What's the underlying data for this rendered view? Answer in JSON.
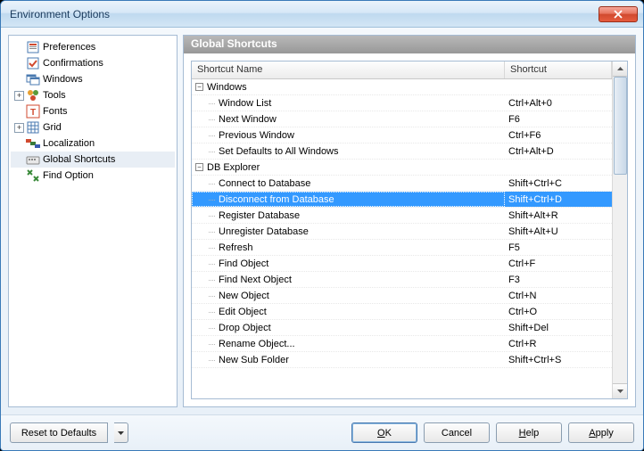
{
  "window": {
    "title": "Environment Options"
  },
  "sidebar": {
    "items": [
      {
        "label": "Preferences",
        "icon": "prefs",
        "level": 0,
        "expander": null
      },
      {
        "label": "Confirmations",
        "icon": "confirm",
        "level": 0,
        "expander": null
      },
      {
        "label": "Windows",
        "icon": "windows",
        "level": 0,
        "expander": null
      },
      {
        "label": "Tools",
        "icon": "tools",
        "level": 0,
        "expander": "plus"
      },
      {
        "label": "Fonts",
        "icon": "fonts",
        "level": 0,
        "expander": null
      },
      {
        "label": "Grid",
        "icon": "grid",
        "level": 0,
        "expander": "plus"
      },
      {
        "label": "Localization",
        "icon": "local",
        "level": 0,
        "expander": null
      },
      {
        "label": "Global Shortcuts",
        "icon": "shortcut",
        "level": 0,
        "expander": null,
        "selected": true
      },
      {
        "label": "Find Option",
        "icon": "find",
        "level": 0,
        "expander": null
      }
    ]
  },
  "main": {
    "title": "Global Shortcuts",
    "columns": {
      "name": "Shortcut Name",
      "shortcut": "Shortcut"
    },
    "rows": [
      {
        "type": "group",
        "label": "Windows",
        "expanded": true
      },
      {
        "type": "item",
        "label": "Window List",
        "shortcut": "Ctrl+Alt+0"
      },
      {
        "type": "item",
        "label": "Next Window",
        "shortcut": "F6"
      },
      {
        "type": "item",
        "label": "Previous Window",
        "shortcut": "Ctrl+F6"
      },
      {
        "type": "item",
        "label": "Set Defaults to All Windows",
        "shortcut": "Ctrl+Alt+D"
      },
      {
        "type": "group",
        "label": "DB Explorer",
        "expanded": true
      },
      {
        "type": "item",
        "label": "Connect to Database",
        "shortcut": "Shift+Ctrl+C"
      },
      {
        "type": "item",
        "label": "Disconnect from Database",
        "shortcut": "Shift+Ctrl+D",
        "selected": true
      },
      {
        "type": "item",
        "label": "Register Database",
        "shortcut": "Shift+Alt+R"
      },
      {
        "type": "item",
        "label": "Unregister Database",
        "shortcut": "Shift+Alt+U"
      },
      {
        "type": "item",
        "label": "Refresh",
        "shortcut": "F5"
      },
      {
        "type": "item",
        "label": "Find Object",
        "shortcut": "Ctrl+F"
      },
      {
        "type": "item",
        "label": "Find Next Object",
        "shortcut": "F3"
      },
      {
        "type": "item",
        "label": "New Object",
        "shortcut": "Ctrl+N"
      },
      {
        "type": "item",
        "label": "Edit Object",
        "shortcut": "Ctrl+O"
      },
      {
        "type": "item",
        "label": "Drop Object",
        "shortcut": "Shift+Del"
      },
      {
        "type": "item",
        "label": "Rename Object...",
        "shortcut": "Ctrl+R"
      },
      {
        "type": "item",
        "label": "New Sub Folder",
        "shortcut": "Shift+Ctrl+S"
      }
    ]
  },
  "footer": {
    "reset": "Reset to Defaults",
    "ok": "OK",
    "cancel": "Cancel",
    "help": "Help",
    "apply": "Apply"
  }
}
